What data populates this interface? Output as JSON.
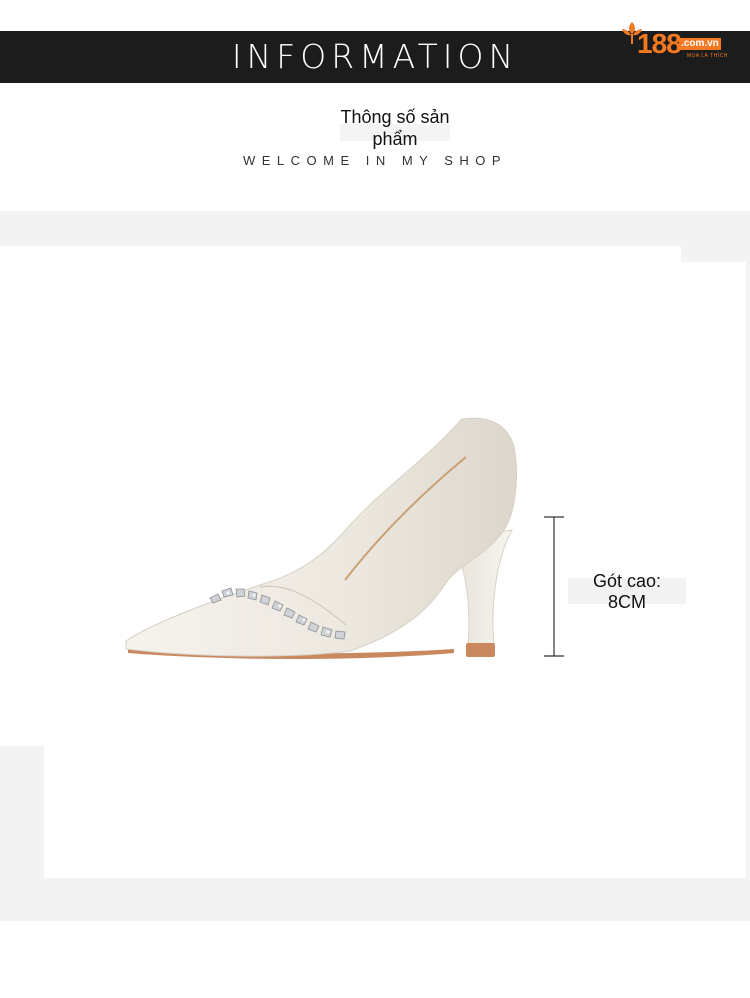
{
  "header": {
    "title": "INFORMATION",
    "logo": {
      "number": "188",
      "domain": ".com.vn",
      "tagline": "MUA LÀ THÍCH",
      "brand_color": "#f47920",
      "icon": "leaf-icon"
    },
    "background_color": "#1c1c1c"
  },
  "intro": {
    "subtitle_line1": "Thông số sản",
    "subtitle_line2": "phẩm",
    "welcome": "WELCOME IN MY SHOP"
  },
  "product": {
    "image": "white-pointed-toe-high-heel-with-crystal-strap",
    "heel_label_line1": "Gót cao:",
    "heel_label_line2": "8CM"
  },
  "colors": {
    "panel": "#f3f3f3",
    "shoe": "#efebe3",
    "sole": "#c9885e"
  }
}
